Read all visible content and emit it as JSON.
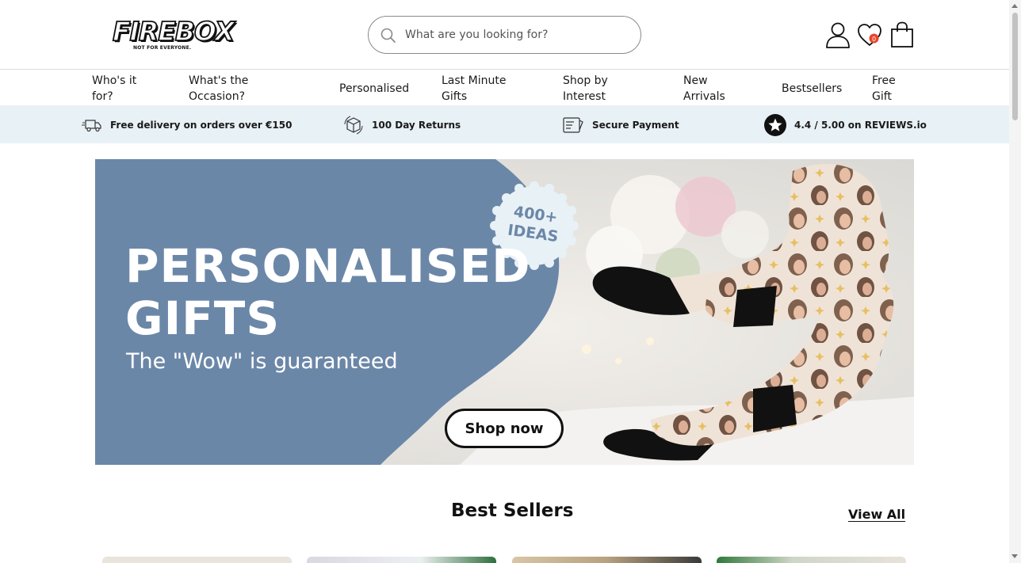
{
  "header": {
    "logo_text": "FIREBOX",
    "logo_tagline": "NOT FOR EVERYONE.",
    "search_placeholder": "What are you looking for?",
    "wishlist_count": "0",
    "icons": [
      "account-icon",
      "wishlist-heart-icon",
      "shopping-bag-icon"
    ]
  },
  "nav": {
    "items": [
      {
        "label": "Who's it for?"
      },
      {
        "label": "What's the Occasion?"
      },
      {
        "label": "Personalised"
      },
      {
        "label": "Last Minute Gifts"
      },
      {
        "label": "Shop by Interest"
      },
      {
        "label": "New Arrivals"
      },
      {
        "label": "Bestsellers"
      },
      {
        "label": "Free Gift"
      }
    ]
  },
  "usp": {
    "items": [
      {
        "icon": "delivery-truck-icon",
        "text": "Free delivery on orders over €150"
      },
      {
        "icon": "returns-box-icon",
        "text": "100 Day Returns"
      },
      {
        "icon": "secure-payment-icon",
        "text": "Secure Payment"
      },
      {
        "icon": "star-rating-icon",
        "text": "4.4 / 5.00 on REVIEWS.io"
      }
    ]
  },
  "hero": {
    "title_line1": "PERSONALISED",
    "title_line2": "GIFTS",
    "subtitle": "The \"Wow\" is guaranteed",
    "badge_line1": "400+",
    "badge_line2": "IDEAS",
    "cta_label": "Shop now",
    "colors": {
      "panel": "#6b87a8",
      "badge": "#e8f1f6"
    }
  },
  "best_sellers": {
    "title": "Best Sellers",
    "view_all_label": "View All"
  }
}
